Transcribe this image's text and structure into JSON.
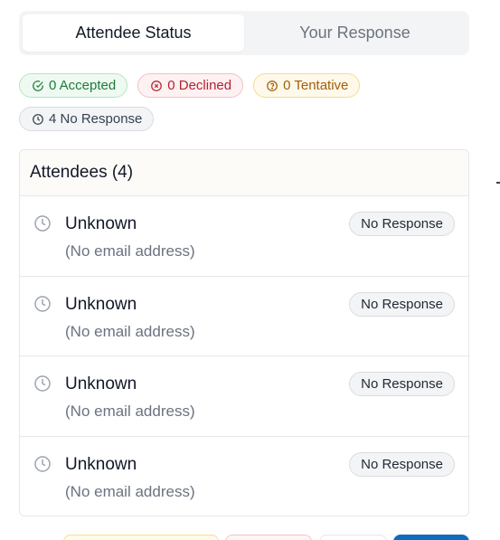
{
  "tabs": [
    {
      "label": "Attendee Status",
      "active": true
    },
    {
      "label": "Your Response",
      "active": false
    }
  ],
  "badges": {
    "accepted": "0 Accepted",
    "declined": "0 Declined",
    "tentative": "0 Tentative",
    "no_response": "4 No Response"
  },
  "colors": {
    "accepted": "#1e7a3a",
    "declined": "#b4232f",
    "tentative": "#a25e0b",
    "no_response": "#374151",
    "primary": "#0f6cbd"
  },
  "attendees": {
    "title": "Attendees (4)",
    "list": [
      {
        "name": "Unknown",
        "email": "(No email address)",
        "status": "No Response",
        "icon": "clock-icon"
      },
      {
        "name": "Unknown",
        "email": "(No email address)",
        "status": "No Response",
        "icon": "clock-icon"
      },
      {
        "name": "Unknown",
        "email": "(No email address)",
        "status": "No Response",
        "icon": "clock-icon"
      },
      {
        "name": "Unknown",
        "email": "(No email address)",
        "status": "No Response",
        "icon": "clock-icon"
      }
    ]
  }
}
